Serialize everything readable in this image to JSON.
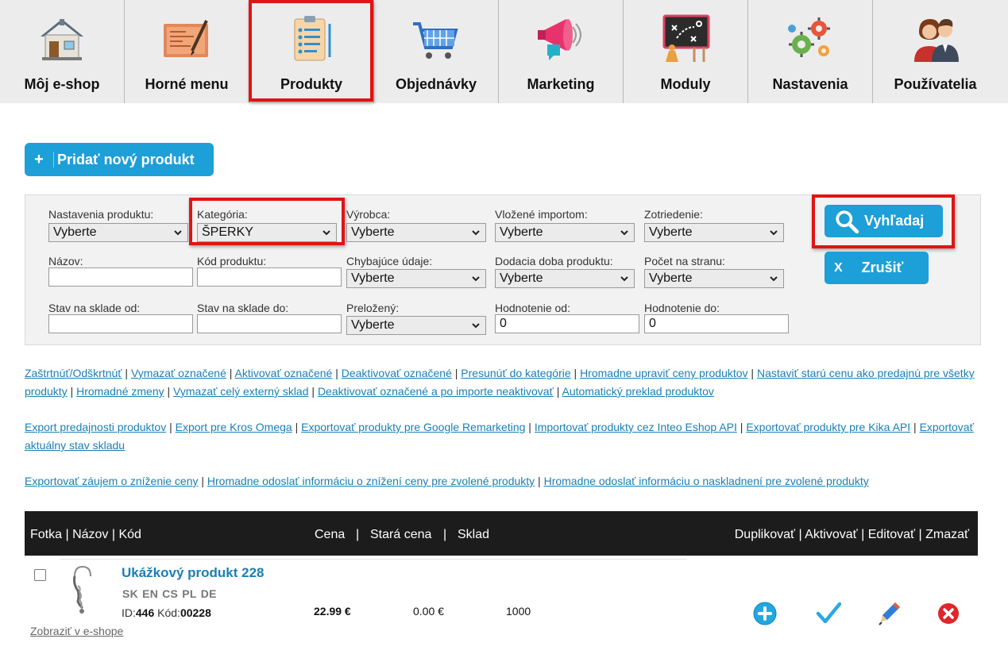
{
  "nav": {
    "tabs": [
      {
        "label": "Môj e-shop",
        "icon": "house-icon"
      },
      {
        "label": "Horné menu",
        "icon": "blueprint-icon"
      },
      {
        "label": "Produkty",
        "icon": "clipboard-icon"
      },
      {
        "label": "Objednávky",
        "icon": "shopping-cart-icon"
      },
      {
        "label": "Marketing",
        "icon": "megaphone-icon"
      },
      {
        "label": "Moduly",
        "icon": "strategy-board-icon"
      },
      {
        "label": "Nastavenia",
        "icon": "gears-icon"
      },
      {
        "label": "Používatelia",
        "icon": "users-icon"
      }
    ],
    "highlighted": "Produkty"
  },
  "add_product_button": "Pridať nový produkt",
  "filters": {
    "product_settings": {
      "label": "Nastavenia produktu:",
      "value": "Vyberte"
    },
    "category": {
      "label": "Kategória:",
      "value": "ŠPERKY"
    },
    "manufacturer": {
      "label": "Výrobca:",
      "value": "Vyberte"
    },
    "import_inserted": {
      "label": "Vložené importom:",
      "value": "Vyberte"
    },
    "sorting": {
      "label": "Zotriedenie:",
      "value": "Vyberte"
    },
    "name": {
      "label": "Názov:",
      "value": ""
    },
    "code": {
      "label": "Kód produktu:",
      "value": ""
    },
    "missing_data": {
      "label": "Chybajúce údaje:",
      "value": "Vyberte"
    },
    "delivery_time": {
      "label": "Dodacia doba produktu:",
      "value": "Vyberte"
    },
    "per_page": {
      "label": "Počet na stranu:",
      "value": "Vyberte"
    },
    "stock_from": {
      "label": "Stav na sklade od:",
      "value": ""
    },
    "stock_to": {
      "label": "Stav na sklade do:",
      "value": ""
    },
    "translated": {
      "label": "Preložený:",
      "value": "Vyberte"
    },
    "rating_from": {
      "label": "Hodnotenie od:",
      "value": "0"
    },
    "rating_to": {
      "label": "Hodnotenie do:",
      "value": "0"
    },
    "search_button": "Vyhľadaj",
    "cancel_button": "Zrušiť"
  },
  "link_groups": [
    [
      "Zaštrtnúť/Odškrtnúť",
      "Vymazať označené",
      "Aktivovať označené",
      "Deaktivovať označené",
      "Presunúť do kategórie",
      "Hromadne upraviť ceny produktov",
      "Nastaviť starú cenu ako predajnú pre všetky produkty",
      "Hromadné zmeny",
      "Vymazať celý externý sklad",
      "Deaktivovať označené a po importe neaktivovať",
      "Automatický preklad produktov"
    ],
    [
      "Export predajnosti produktov",
      "Export pre Kros Omega",
      "Exportovať produkty pre Google Remarketing",
      "Importovať produkty cez Inteo Eshop API",
      "Exportovať produkty pre Kika API",
      "Exportovať aktuálny stav skladu"
    ],
    [
      "Exportovať záujem o zníženie ceny",
      "Hromadne odoslať informáciu o znížení ceny pre zvolené produkty",
      "Hromadne odoslať informáciu o naskladnení pre zvolené produkty"
    ]
  ],
  "table": {
    "header_left": "Fotka | Názov | Kód",
    "header_price": "Cena",
    "header_old_price": "Stará cena",
    "header_stock": "Sklad",
    "header_actions": "Duplikovať | Aktivovať | Editovať | Zmazať",
    "sep": "|",
    "rows": [
      {
        "name": "Ukážkový produkt 228",
        "languages": [
          "SK",
          "EN",
          "CS",
          "PL",
          "DE"
        ],
        "id_label": "ID:",
        "id": "446",
        "code_label": "Kód:",
        "code": "00228",
        "price": "22.99 €",
        "old_price": "0.00 €",
        "stock": "1000",
        "show_link": "Zobraziť v e-shope"
      }
    ]
  },
  "colors": {
    "accent": "#1d9fd8",
    "link": "#1b7fb3",
    "highlight": "#e01414",
    "header_bg": "#1c1c1c"
  }
}
